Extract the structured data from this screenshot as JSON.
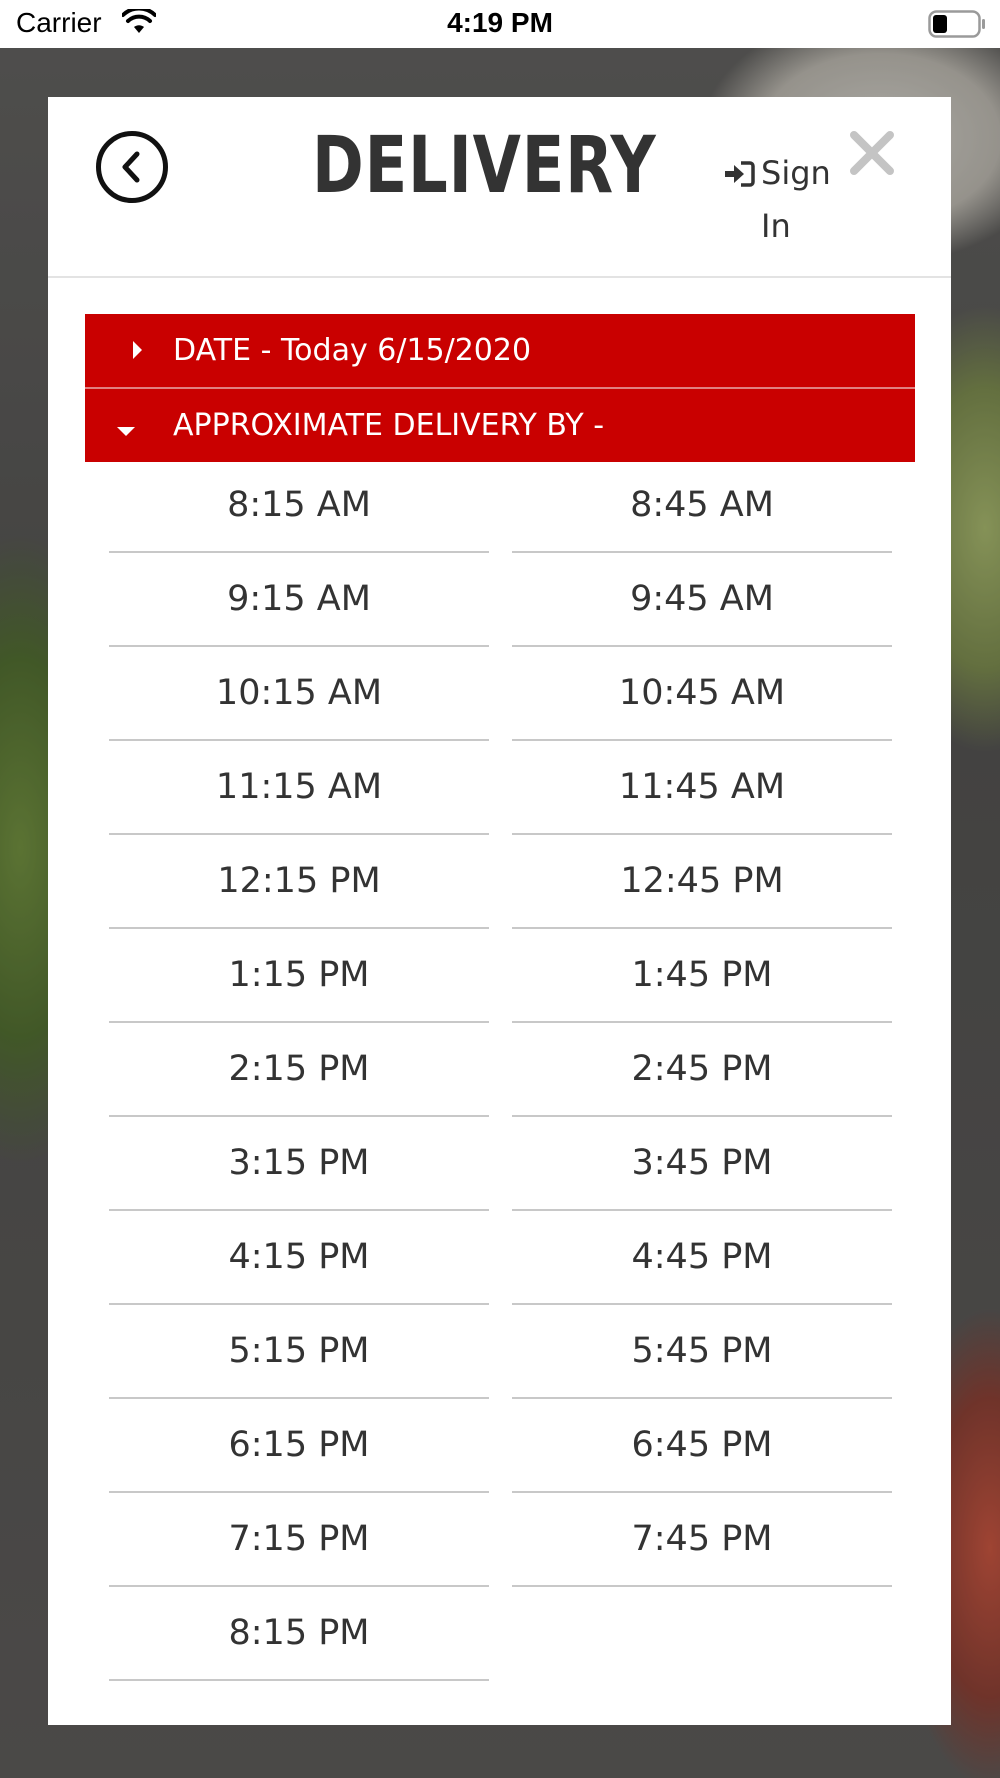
{
  "status_bar": {
    "carrier": "Carrier",
    "time": "4:19 PM"
  },
  "header": {
    "title": "DELIVERY",
    "sign_in_word1": "Sign",
    "sign_in_word2": "In",
    "back_icon": "chevron-left-circle-icon",
    "close_icon": "close-icon"
  },
  "accordion": {
    "date_label": "DATE - Today 6/15/2020",
    "delivery_label": "APPROXIMATE DELIVERY BY -",
    "accent_color": "#c90000"
  },
  "times": [
    "8:15 AM",
    "8:45 AM",
    "9:15 AM",
    "9:45 AM",
    "10:15 AM",
    "10:45 AM",
    "11:15 AM",
    "11:45 AM",
    "12:15 PM",
    "12:45 PM",
    "1:15 PM",
    "1:45 PM",
    "2:15 PM",
    "2:45 PM",
    "3:15 PM",
    "3:45 PM",
    "4:15 PM",
    "4:45 PM",
    "5:15 PM",
    "5:45 PM",
    "6:15 PM",
    "6:45 PM",
    "7:15 PM",
    "7:45 PM",
    "8:15 PM"
  ]
}
